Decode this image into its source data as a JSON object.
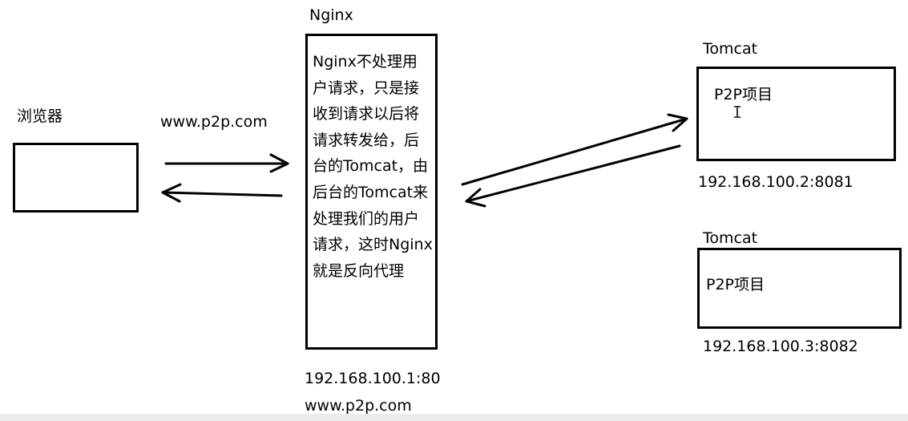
{
  "browser": {
    "label": "浏览器"
  },
  "request": {
    "url_label": "www.p2p.com"
  },
  "nginx": {
    "title": "Nginx",
    "description_lines": [
      "Nginx不处理用",
      "户请求，只是接",
      "收到请求以后将",
      "请求转发给，后",
      "台的Tomcat，由",
      "后台的Tomcat来",
      "处理我们的用户",
      "请求，这时Nginx",
      "就是反向代理"
    ],
    "address": "192.168.100.1:80",
    "domain": "www.p2p.com"
  },
  "tomcats": [
    {
      "title": "Tomcat",
      "content": "P2P项目",
      "address": "192.168.100.2:8081"
    },
    {
      "title": "Tomcat",
      "content": "P2P项目",
      "address": "192.168.100.3:8082"
    }
  ],
  "colors": {
    "stroke": "#000000",
    "background": "#ffffff"
  }
}
